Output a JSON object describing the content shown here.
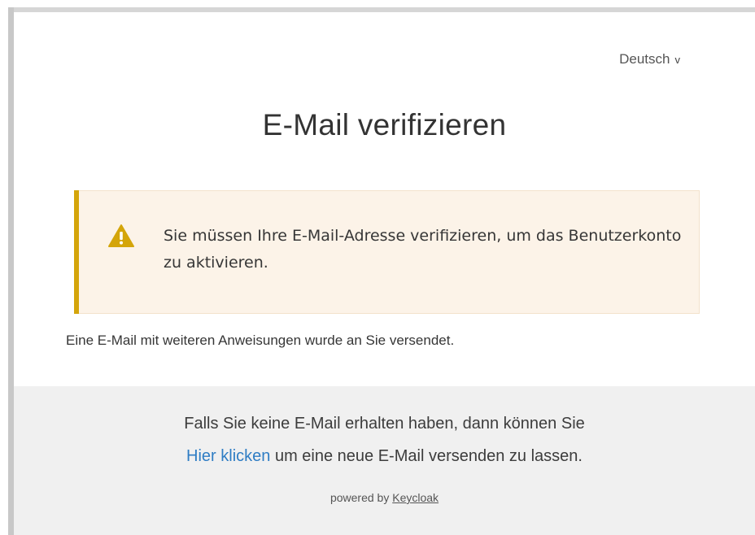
{
  "locale": {
    "current": "Deutsch",
    "chevron": "v"
  },
  "page": {
    "title": "E-Mail verifizieren"
  },
  "alert": {
    "type": "warning",
    "icon": "warning-triangle-icon",
    "accent_color": "#d4a50a",
    "background_color": "#fcf3e8",
    "message": "Sie müssen Ihre E-Mail-Adresse verifizieren, um das Benutzerkonto zu aktivieren."
  },
  "info": {
    "text": "Eine E-Mail mit weiteren Anweisungen wurde an Sie versendet."
  },
  "footer": {
    "line1": "Falls Sie keine E-Mail erhalten haben, dann können Sie",
    "link_label": "Hier klicken",
    "line2_rest": " um eine neue E-Mail versenden zu lassen.",
    "link_color": "#2f7dc4",
    "powered_prefix": "powered by ",
    "powered_link": "Keycloak"
  }
}
